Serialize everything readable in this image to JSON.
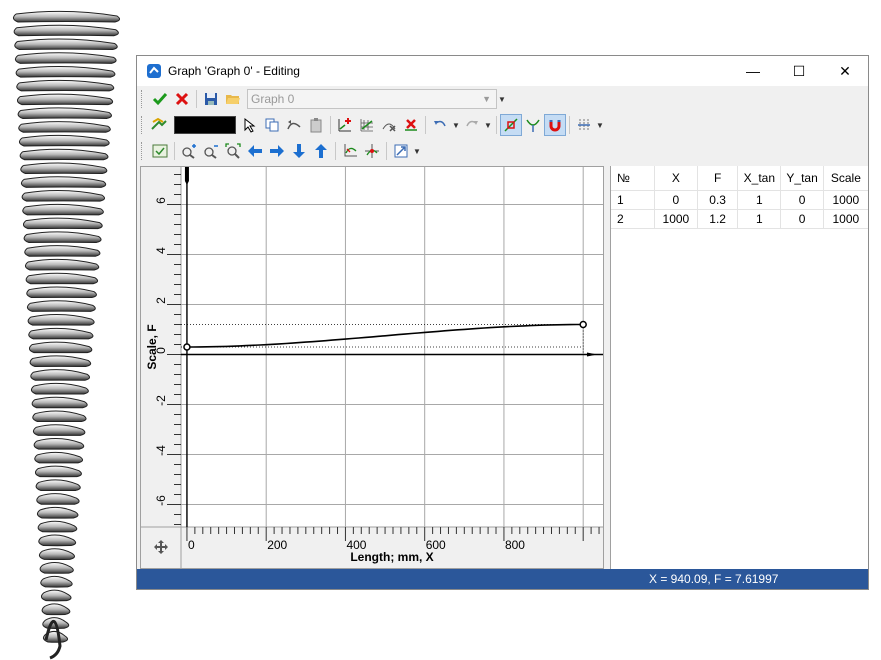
{
  "window": {
    "title": "Graph 'Graph 0' - Editing",
    "minimize_glyph": "—",
    "maximize_glyph": "☐",
    "close_glyph": "✕"
  },
  "toolbar1": {
    "graph_combo_value": "Graph 0",
    "icons": [
      "check-icon",
      "cancel-icon",
      "save-icon",
      "open-folder-icon"
    ]
  },
  "toolbar2": {
    "line_color": "#000000",
    "icons": [
      "color-picker-icon",
      "select-pointer-icon",
      "copy-icon",
      "undo-curve-icon",
      "paste-icon",
      "add-point-icon",
      "grid-points-icon",
      "delete-point-icon",
      "remove-point-icon",
      "undo-icon",
      "redo-icon",
      "snap-node-icon",
      "tangent-icon",
      "magnet-icon",
      "settings-icon"
    ]
  },
  "toolbar3": {
    "icons": [
      "view-icon",
      "zoom-in-icon",
      "zoom-out-icon",
      "zoom-fit-icon",
      "arrow-left-icon",
      "arrow-right-icon",
      "arrow-down-icon",
      "arrow-up-icon",
      "axes-icon",
      "center-axes-icon",
      "export-icon"
    ]
  },
  "plot": {
    "ylabel": "Scale, F",
    "xlabel": "Length; mm, X",
    "x_ticks": [
      "0",
      "200",
      "400",
      "600",
      "800"
    ],
    "y_ticks": [
      "6",
      "4",
      "2",
      "0",
      "-2",
      "-4",
      "-6"
    ],
    "pan_icon": "move-icon"
  },
  "chart_data": {
    "type": "line",
    "title": "",
    "xlabel": "Length; mm, X",
    "ylabel": "Scale, F",
    "x": [
      0,
      1000
    ],
    "series": [
      {
        "values": [
          0.3,
          1.2
        ]
      }
    ],
    "xlim": [
      -15,
      1050
    ],
    "ylim": [
      -6.9,
      7.5
    ],
    "grid": true
  },
  "table": {
    "columns": [
      "№",
      "X",
      "F",
      "X_tan",
      "Y_tan",
      "Scale"
    ],
    "rows": [
      [
        "1",
        "0",
        "0.3",
        "1",
        "0",
        "1000"
      ],
      [
        "2",
        "1000",
        "1.2",
        "1",
        "0",
        "1000"
      ]
    ]
  },
  "status": {
    "text": "X = 940.09, F = 7.61997",
    "bg_color": "#2b579a"
  }
}
